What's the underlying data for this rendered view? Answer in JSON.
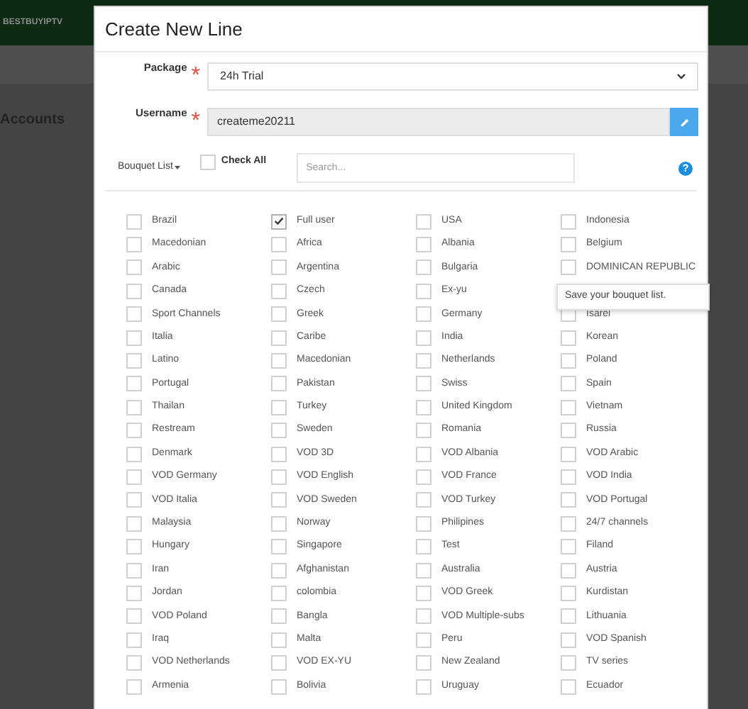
{
  "background": {
    "logo": "BESTBUYIPTV",
    "page_title": "Accounts"
  },
  "modal": {
    "title": "Create New Line",
    "package": {
      "label": "Package",
      "required_mark": "*",
      "value": "24h Trial"
    },
    "username": {
      "label": "Username",
      "required_mark": "*",
      "value": "createme20211"
    },
    "bouquet_menu": "Bouquet List",
    "check_all": {
      "label": "Check All",
      "checked": false
    },
    "search": {
      "placeholder": "Search..."
    },
    "help": "?",
    "bouquets": [
      {
        "label": "Brazil",
        "checked": false
      },
      {
        "label": "Full user",
        "checked": true
      },
      {
        "label": "USA",
        "checked": false
      },
      {
        "label": "Indonesia",
        "checked": false
      },
      {
        "label": "Macedonian",
        "checked": false
      },
      {
        "label": "Africa",
        "checked": false
      },
      {
        "label": "Albania",
        "checked": false
      },
      {
        "label": "Belgium",
        "checked": false
      },
      {
        "label": "Arabic",
        "checked": false
      },
      {
        "label": "Argentina",
        "checked": false
      },
      {
        "label": "Bulgaria",
        "checked": false
      },
      {
        "label": "DOMINICAN REPUBLIC",
        "checked": false
      },
      {
        "label": "Canada",
        "checked": false
      },
      {
        "label": "Czech",
        "checked": false
      },
      {
        "label": "Ex-yu",
        "checked": false
      },
      {
        "kind": "tooltip",
        "label": "Save your bouquet list."
      },
      {
        "label": "Sport Channels",
        "checked": false
      },
      {
        "label": "Greek",
        "checked": false
      },
      {
        "label": "Germany",
        "checked": false
      },
      {
        "label": "Isarel",
        "checked": false
      },
      {
        "label": "Italia",
        "checked": false
      },
      {
        "label": "Caribe",
        "checked": false
      },
      {
        "label": "India",
        "checked": false
      },
      {
        "label": "Korean",
        "checked": false
      },
      {
        "label": "Latino",
        "checked": false
      },
      {
        "label": "Macedonian",
        "checked": false
      },
      {
        "label": "Netherlands",
        "checked": false
      },
      {
        "label": "Poland",
        "checked": false
      },
      {
        "label": "Portugal",
        "checked": false
      },
      {
        "label": "Pakistan",
        "checked": false
      },
      {
        "label": "Swiss",
        "checked": false
      },
      {
        "label": "Spain",
        "checked": false
      },
      {
        "label": "Thailan",
        "checked": false
      },
      {
        "label": "Turkey",
        "checked": false
      },
      {
        "label": "United Kingdom",
        "checked": false
      },
      {
        "label": "Vietnam",
        "checked": false
      },
      {
        "label": "Restream",
        "checked": false
      },
      {
        "label": "Sweden",
        "checked": false
      },
      {
        "label": "Romania",
        "checked": false
      },
      {
        "label": "Russia",
        "checked": false
      },
      {
        "label": "Denmark",
        "checked": false
      },
      {
        "label": "VOD 3D",
        "checked": false
      },
      {
        "label": "VOD Albania",
        "checked": false
      },
      {
        "label": "VOD Arabic",
        "checked": false
      },
      {
        "label": "VOD Germany",
        "checked": false
      },
      {
        "label": "VOD English",
        "checked": false
      },
      {
        "label": "VOD France",
        "checked": false
      },
      {
        "label": "VOD India",
        "checked": false
      },
      {
        "label": "VOD Italia",
        "checked": false
      },
      {
        "label": "VOD Sweden",
        "checked": false
      },
      {
        "label": "VOD Turkey",
        "checked": false
      },
      {
        "label": "VOD Portugal",
        "checked": false
      },
      {
        "label": "Malaysia",
        "checked": false
      },
      {
        "label": "Norway",
        "checked": false
      },
      {
        "label": "Philipines",
        "checked": false
      },
      {
        "label": "24/7 channels",
        "checked": false
      },
      {
        "label": "Hungary",
        "checked": false
      },
      {
        "label": "Singapore",
        "checked": false
      },
      {
        "label": "Test",
        "checked": false
      },
      {
        "label": "Filand",
        "checked": false
      },
      {
        "label": "Iran",
        "checked": false
      },
      {
        "label": "Afghanistan",
        "checked": false
      },
      {
        "label": "Australia",
        "checked": false
      },
      {
        "label": "Austria",
        "checked": false
      },
      {
        "label": "Jordan",
        "checked": false
      },
      {
        "label": "colombia",
        "checked": false
      },
      {
        "label": "VOD Greek",
        "checked": false
      },
      {
        "label": "Kurdistan",
        "checked": false
      },
      {
        "label": "VOD Poland",
        "checked": false
      },
      {
        "label": "Bangla",
        "checked": false
      },
      {
        "label": "VOD Multiple-subs",
        "checked": false
      },
      {
        "label": "Lithuania",
        "checked": false
      },
      {
        "label": "Iraq",
        "checked": false
      },
      {
        "label": "Malta",
        "checked": false
      },
      {
        "label": "Peru",
        "checked": false
      },
      {
        "label": "VOD Spanish",
        "checked": false
      },
      {
        "label": "VOD Netherlands",
        "checked": false
      },
      {
        "label": "VOD EX-YU",
        "checked": false
      },
      {
        "label": "New Zealand",
        "checked": false
      },
      {
        "label": "TV series",
        "checked": false
      },
      {
        "label": "Armenia",
        "checked": false
      },
      {
        "label": "Bolivia",
        "checked": false
      },
      {
        "label": "Uruguay",
        "checked": false
      },
      {
        "label": "Ecuador",
        "checked": false
      }
    ]
  }
}
